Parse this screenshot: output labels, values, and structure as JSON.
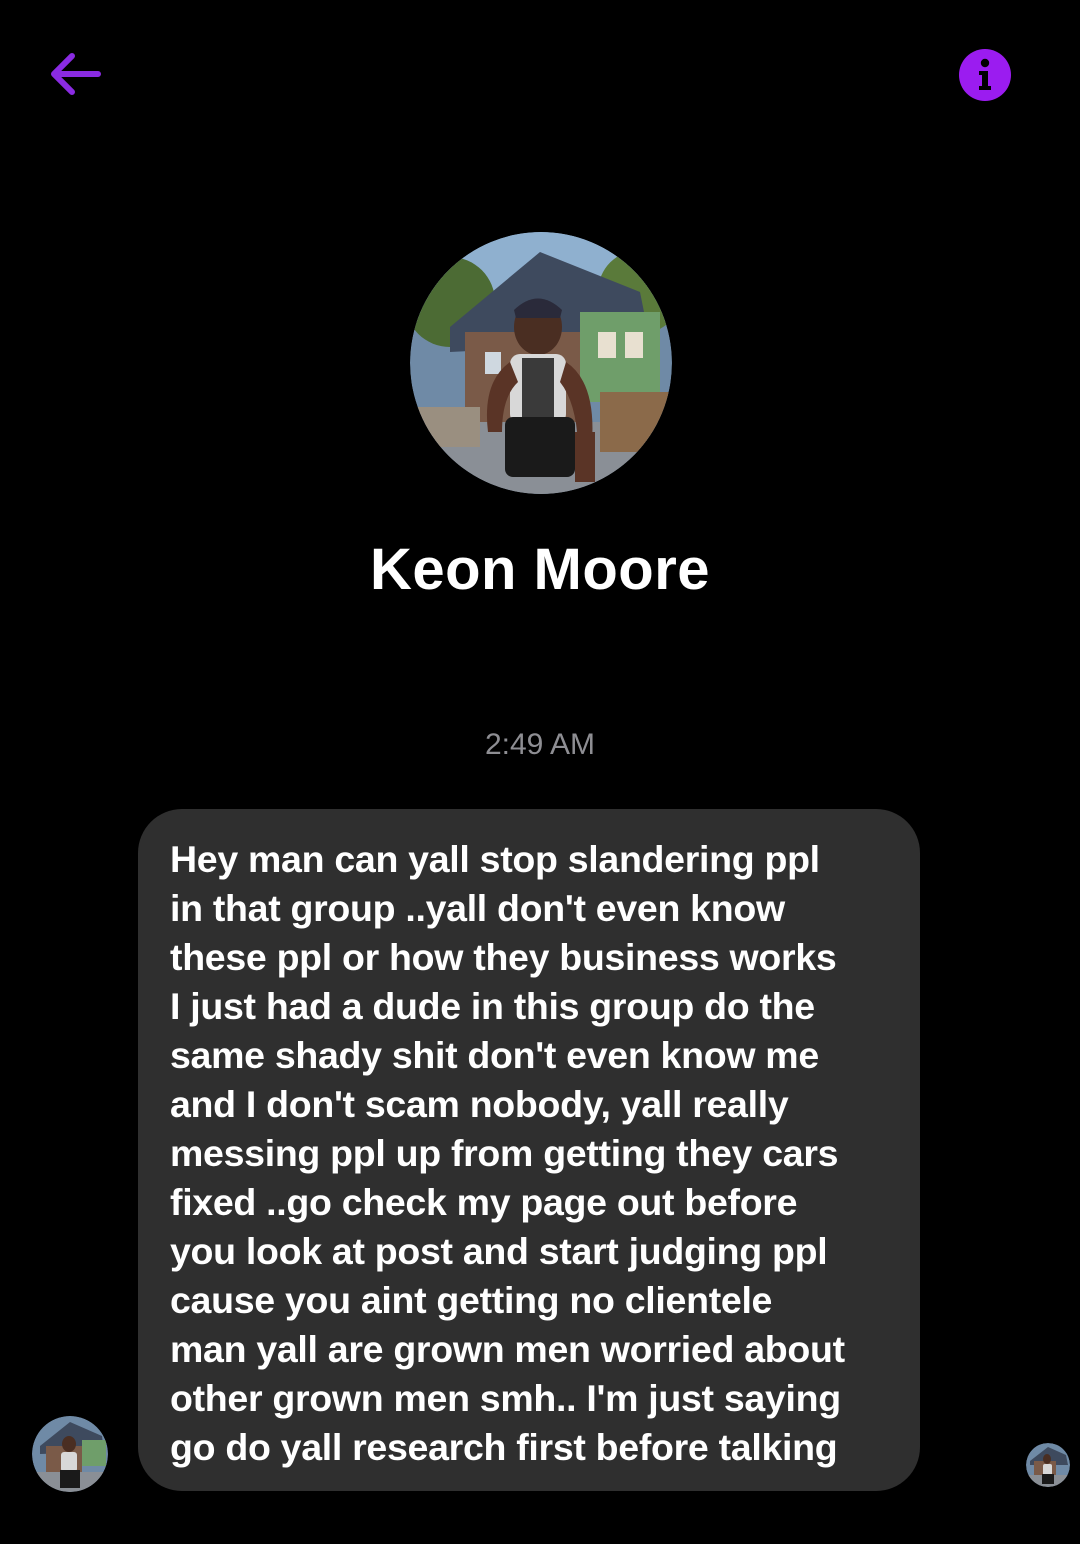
{
  "header": {
    "back_icon": "arrow-left-icon",
    "info_icon": "info-circle-icon",
    "accent_color": "#8a2be2"
  },
  "profile": {
    "name": "Keon Moore",
    "avatar": "profile-photo-avatar"
  },
  "conversation": {
    "timestamp": "2:49 AM",
    "messages": [
      {
        "sender": "Keon Moore",
        "text": "Hey man can yall stop slandering ppl\nin that group ..yall don't even know\nthese ppl or how they business works\nI just had a dude in this group do the\nsame shady shit don't even know me\nand I don't scam nobody, yall really\nmessing ppl up from getting they cars\nfixed ..go check my page out before\nyou look at post and start judging ppl\ncause you aint getting no clientele\nman yall are grown men worried about\nother grown men smh.. I'm just saying\ngo do yall research first before talking"
      }
    ]
  },
  "colors": {
    "background": "#000000",
    "bubble": "#2f2f2f",
    "timestamp": "#8e8e93",
    "accent": "#8a2be2"
  }
}
